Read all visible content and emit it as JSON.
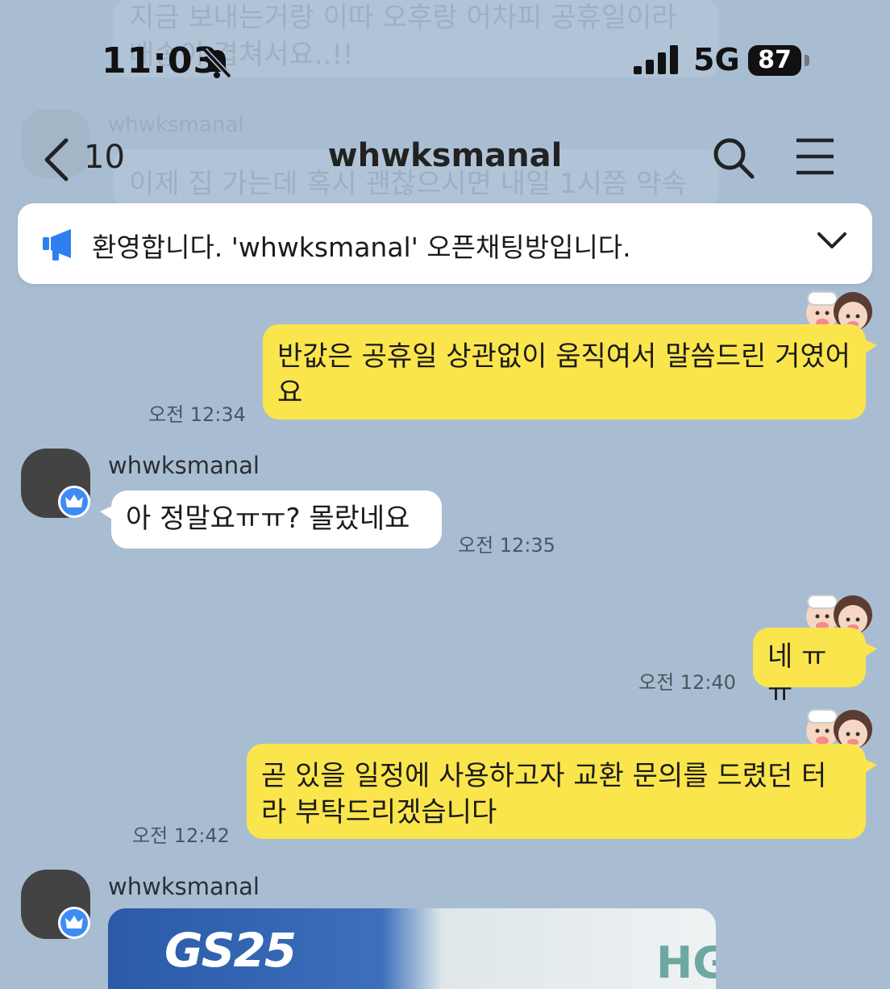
{
  "status_bar": {
    "time": "11:03",
    "network": "5G",
    "battery": "87"
  },
  "nav": {
    "back_count": "10",
    "title": "whwksmanal"
  },
  "notice": {
    "text": "환영합니다. 'whwksmanal' 오픈채팅방입니다."
  },
  "background_ghost": {
    "line1": "지금 보내는거랑 이따 오후랑 어차피 공휴일이라",
    "line2": "배송이 겹쳐서요..!!",
    "sender": "whwksmanal",
    "line3": "이제 집 가는데 혹시 괜찮으시면 내일 1시쯤 약속"
  },
  "messages": [
    {
      "side": "me",
      "text": "반값은 공휴일 상관없이 움직여서 말씀드린 거였어요",
      "time": "오전 12:34"
    },
    {
      "side": "them",
      "sender": "whwksmanal",
      "text": "아 정말요ㅠㅠ? 몰랐네요",
      "time": "오전 12:35"
    },
    {
      "side": "me",
      "text": "네 ㅠㅠ",
      "time": "오전 12:40"
    },
    {
      "side": "me",
      "text": "곧 있을 일정에 사용하고자 교환 문의를 드렸던 터라 부탁드리겠습니다",
      "time": "오전 12:42"
    },
    {
      "side": "them",
      "sender": "whwksmanal",
      "type": "image",
      "photo_sign": "GS25",
      "photo_right": "HG"
    }
  ],
  "colors": {
    "background": "#a9bdd2",
    "my_bubble": "#fbe54d",
    "their_bubble": "#ffffff",
    "badge": "#3d8cf5"
  }
}
